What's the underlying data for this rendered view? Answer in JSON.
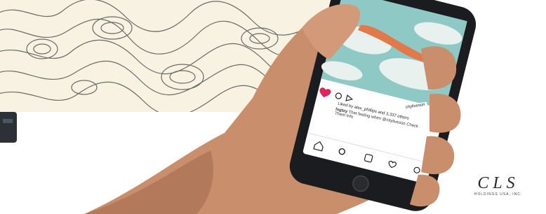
{
  "post": {
    "liked_by": "Liked by alex_phillips and 3,337 others",
    "caption_user": "lsgtxy",
    "caption_text": "That feeling when @cityliveson Check Them Info",
    "photo_tag": "cityliveson"
  },
  "brand": {
    "logo_mark": "CLS",
    "logo_sub": "HOLDINGS USA, INC."
  },
  "colors": {
    "topo_background": "#f7f2e2",
    "topo_lines": "#6b6b66",
    "sky": "#8fc9c6",
    "cloud": "#e9f1ee",
    "skin": "#c98f6c",
    "phone_body": "#1b1c1f",
    "like_heart": "#e0245e"
  },
  "icons": [
    "heart-icon",
    "comment-icon",
    "share-icon",
    "bookmark-icon",
    "home-icon",
    "search-icon",
    "add-post-icon",
    "activity-icon",
    "profile-icon"
  ]
}
